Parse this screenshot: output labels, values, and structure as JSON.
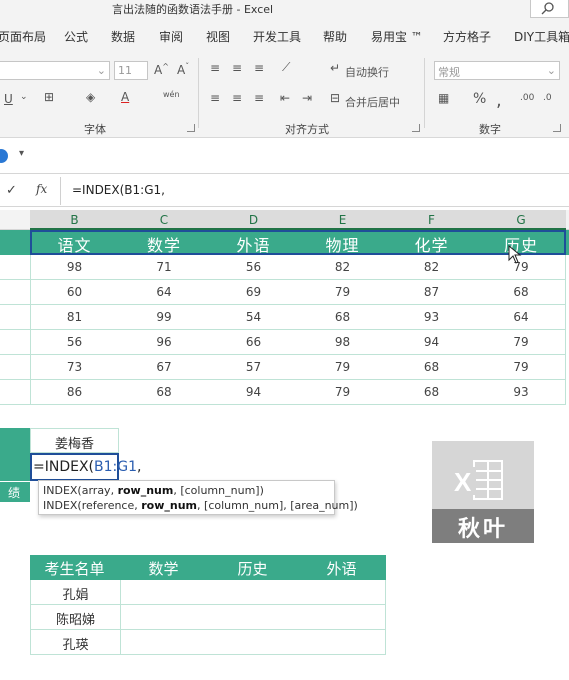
{
  "window": {
    "title": "言出法随的函数语法手册  -  Excel"
  },
  "menu": [
    "页面布局",
    "公式",
    "数据",
    "审阅",
    "视图",
    "开发工具",
    "帮助",
    "易用宝 ™",
    "方方格子",
    "DIY工具箱"
  ],
  "ribbon": {
    "font_size": "11",
    "wrap_text": "自动换行",
    "merge_center": "合并后居中",
    "number_format": "常规",
    "groups": {
      "font": "字体",
      "alignment": "对齐方式",
      "number": "数字"
    }
  },
  "formula_bar": {
    "fx": "fx",
    "formula": "=INDEX(B1:G1,"
  },
  "columns": [
    "B",
    "C",
    "D",
    "E",
    "F",
    "G"
  ],
  "table1": {
    "headers": [
      "语文",
      "数学",
      "外语",
      "物理",
      "化学",
      "历史"
    ],
    "rows": [
      [
        "98",
        "71",
        "56",
        "82",
        "82",
        "79"
      ],
      [
        "60",
        "64",
        "69",
        "79",
        "87",
        "68"
      ],
      [
        "81",
        "99",
        "54",
        "68",
        "93",
        "64"
      ],
      [
        "56",
        "96",
        "66",
        "98",
        "94",
        "79"
      ],
      [
        "73",
        "67",
        "57",
        "79",
        "68",
        "79"
      ],
      [
        "86",
        "68",
        "94",
        "79",
        "68",
        "93"
      ]
    ]
  },
  "lookup": {
    "name": "姜梅香",
    "formula_prefix": "=INDEX(",
    "formula_ref": "B1:G1",
    "formula_suffix": ",",
    "side_label": "绩"
  },
  "tooltip": {
    "line1_a": "INDEX(array, ",
    "line1_b": "row_num",
    "line1_c": ", [column_num])",
    "line2_a": "INDEX(reference, ",
    "line2_b": "row_num",
    "line2_c": ", [column_num], [area_num])"
  },
  "logo": {
    "label": "秋叶"
  },
  "table2": {
    "headers": [
      "考生名单",
      "数学",
      "历史",
      "外语"
    ],
    "rows": [
      "孔娟",
      "陈昭娣",
      "孔瑛"
    ]
  },
  "colors": {
    "teal_header": "#3aaa8b",
    "selection_border": "#1f4e99",
    "excel_green": "#217346"
  }
}
